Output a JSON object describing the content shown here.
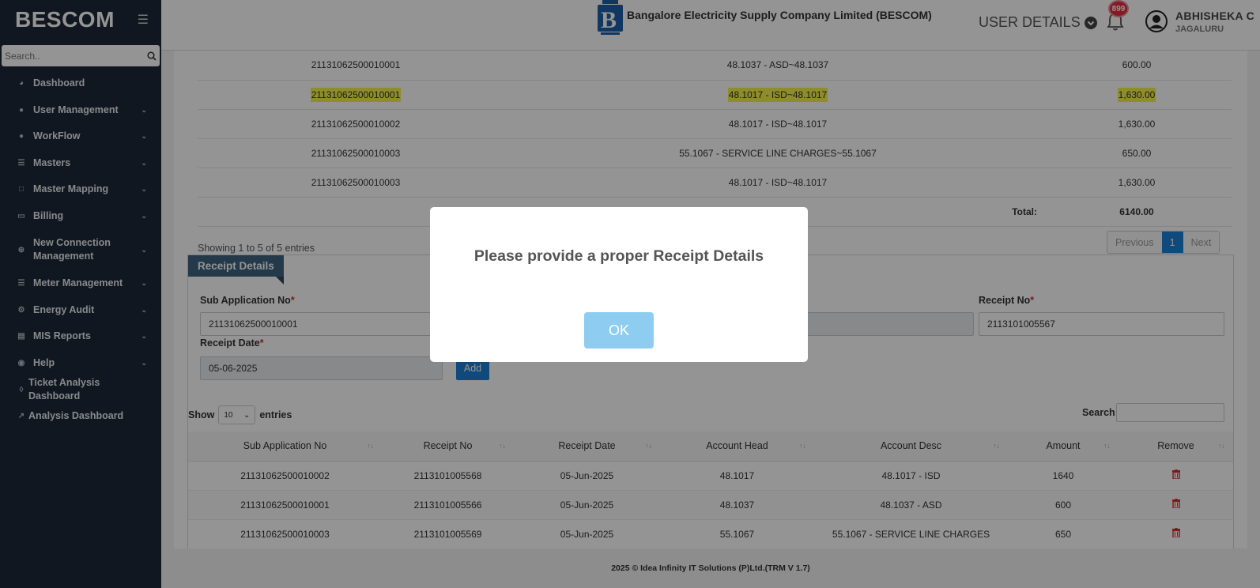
{
  "sidebar": {
    "brand": "BESCOM",
    "search_placeholder": "Search..",
    "items": [
      {
        "label": "Dashboard",
        "icon": "dashboard-icon"
      },
      {
        "label": "User Management",
        "icon": "user-icon"
      },
      {
        "label": "WorkFlow",
        "icon": "user-icon"
      },
      {
        "label": "Masters",
        "icon": "list-icon"
      },
      {
        "label": "Master Mapping",
        "icon": "sitemap-icon"
      },
      {
        "label": "Billing",
        "icon": "monitor-icon"
      },
      {
        "label": "New Connection Management",
        "icon": "plus-circle-icon"
      },
      {
        "label": "Meter Management",
        "icon": "list-icon"
      },
      {
        "label": "Energy Audit",
        "icon": "cogs-icon"
      },
      {
        "label": "MIS Reports",
        "icon": "bar-chart-icon"
      },
      {
        "label": "Help",
        "icon": "help-icon"
      },
      {
        "label": "Ticket Analysis Dashboard",
        "icon": "tag-icon"
      },
      {
        "label": "Analysis Dashboard",
        "icon": "line-chart-icon"
      }
    ]
  },
  "header": {
    "company_name": "Bangalore Electricity Supply Company Limited (BESCOM)",
    "user_details_label": "USER DETAILS",
    "notification_count": "899",
    "user_name": "ABHISHEKA C",
    "user_location": "JAGALURU"
  },
  "fee_table": {
    "rows": [
      {
        "sub_app": "21131062500010001",
        "head": "48.1037 - ASD~48.1037",
        "amount": "600.00",
        "highlight": false
      },
      {
        "sub_app": "21131062500010001",
        "head": "48.1017 - ISD~48.1017",
        "amount": "1,630.00",
        "highlight": true
      },
      {
        "sub_app": "21131062500010002",
        "head": "48.1017 - ISD~48.1017",
        "amount": "1,630.00",
        "highlight": false
      },
      {
        "sub_app": "21131062500010003",
        "head": "55.1067 - SERVICE LINE CHARGES~55.1067",
        "amount": "650.00",
        "highlight": false
      },
      {
        "sub_app": "21131062500010003",
        "head": "48.1017 - ISD~48.1017",
        "amount": "1,630.00",
        "highlight": false
      }
    ],
    "total_label": "Total:",
    "total_value": "6140.00",
    "showing_text": "Showing 1 to 5 of 5 entries",
    "pager": {
      "previous": "Previous",
      "current": "1",
      "next": "Next"
    }
  },
  "receipt_panel": {
    "title": "Receipt Details",
    "sub_app_label": "Sub Application No",
    "sub_app_value": "21131062500010001",
    "receipt_no_label": "Receipt No",
    "receipt_no_value": "2113101005567",
    "receipt_date_label": "Receipt Date",
    "receipt_date_value": "05-06-2025",
    "required_mark": "*",
    "add_label": "Add",
    "show_label": "Show",
    "entries_value": "10",
    "entries_label": "entries",
    "search_label": "Search:"
  },
  "receipt_table": {
    "headers": [
      "Sub Application No",
      "Receipt No",
      "Receipt Date",
      "Account Head",
      "Account Desc",
      "Amount",
      "Remove"
    ],
    "sort_glyph": "↑↓",
    "rows": [
      [
        "21131062500010002",
        "2113101005568",
        "05-Jun-2025",
        "48.1017",
        "48.1017 - ISD",
        "1640"
      ],
      [
        "21131062500010001",
        "2113101005566",
        "05-Jun-2025",
        "48.1037",
        "48.1037 - ASD",
        "600"
      ],
      [
        "21131062500010003",
        "2113101005569",
        "05-Jun-2025",
        "55.1067",
        "55.1067 - SERVICE LINE CHARGES",
        "650"
      ]
    ]
  },
  "footer": {
    "text": "2025 © Idea Infinity IT Solutions (P)Ltd.(TRM V 1.7)"
  },
  "modal": {
    "message": "Please provide a proper Receipt Details",
    "ok_label": "OK"
  },
  "colors": {
    "sidebar_bg": "#1e2837",
    "accent": "#1d7ed4",
    "highlight": "#f5f14a",
    "danger": "#e0303e"
  }
}
